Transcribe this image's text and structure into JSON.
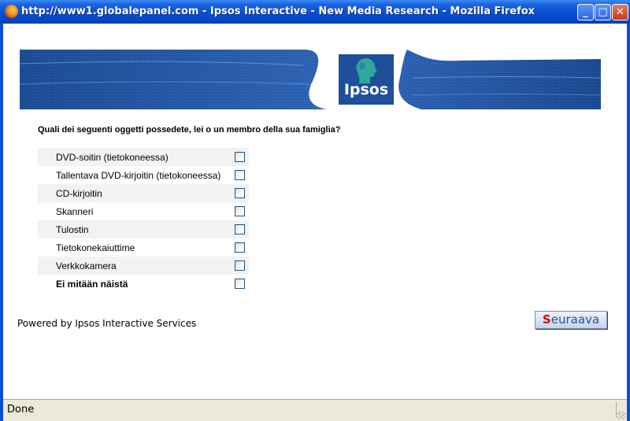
{
  "window": {
    "title": "http://www1.globalepanel.com - Ipsos Interactive - New Media Research - Mozilla Firefox",
    "minimize_label": "_",
    "maximize_label": "□",
    "close_label": "✕"
  },
  "banner": {
    "logo_text": "Ipsos"
  },
  "survey": {
    "question": "Quali dei seguenti oggetti possedete, lei o un membro della sua famiglia?",
    "options": [
      {
        "label": "DVD-soitin (tietokoneessa)",
        "checked": false
      },
      {
        "label": "Tallentava DVD-kirjoitin (tietokoneessa)",
        "checked": false
      },
      {
        "label": "CD-kirjoitin",
        "checked": false
      },
      {
        "label": "Skanneri",
        "checked": false
      },
      {
        "label": "Tulostin",
        "checked": false
      },
      {
        "label": "Tietokonekaiuttime",
        "checked": false
      },
      {
        "label": "Verkkokamera",
        "checked": false
      },
      {
        "label": "Ei mitään näistä",
        "checked": false
      }
    ],
    "next_first_letter": "S",
    "next_rest": "euraava"
  },
  "footer": {
    "powered_by": "Powered by Ipsos Interactive Services"
  },
  "statusbar": {
    "status": "Done"
  },
  "colors": {
    "titlebar": "#0a4fd6",
    "banner_blue": "#1f4f9a",
    "logo_teal": "#2fa79a",
    "next_accent": "#d10f0f"
  }
}
